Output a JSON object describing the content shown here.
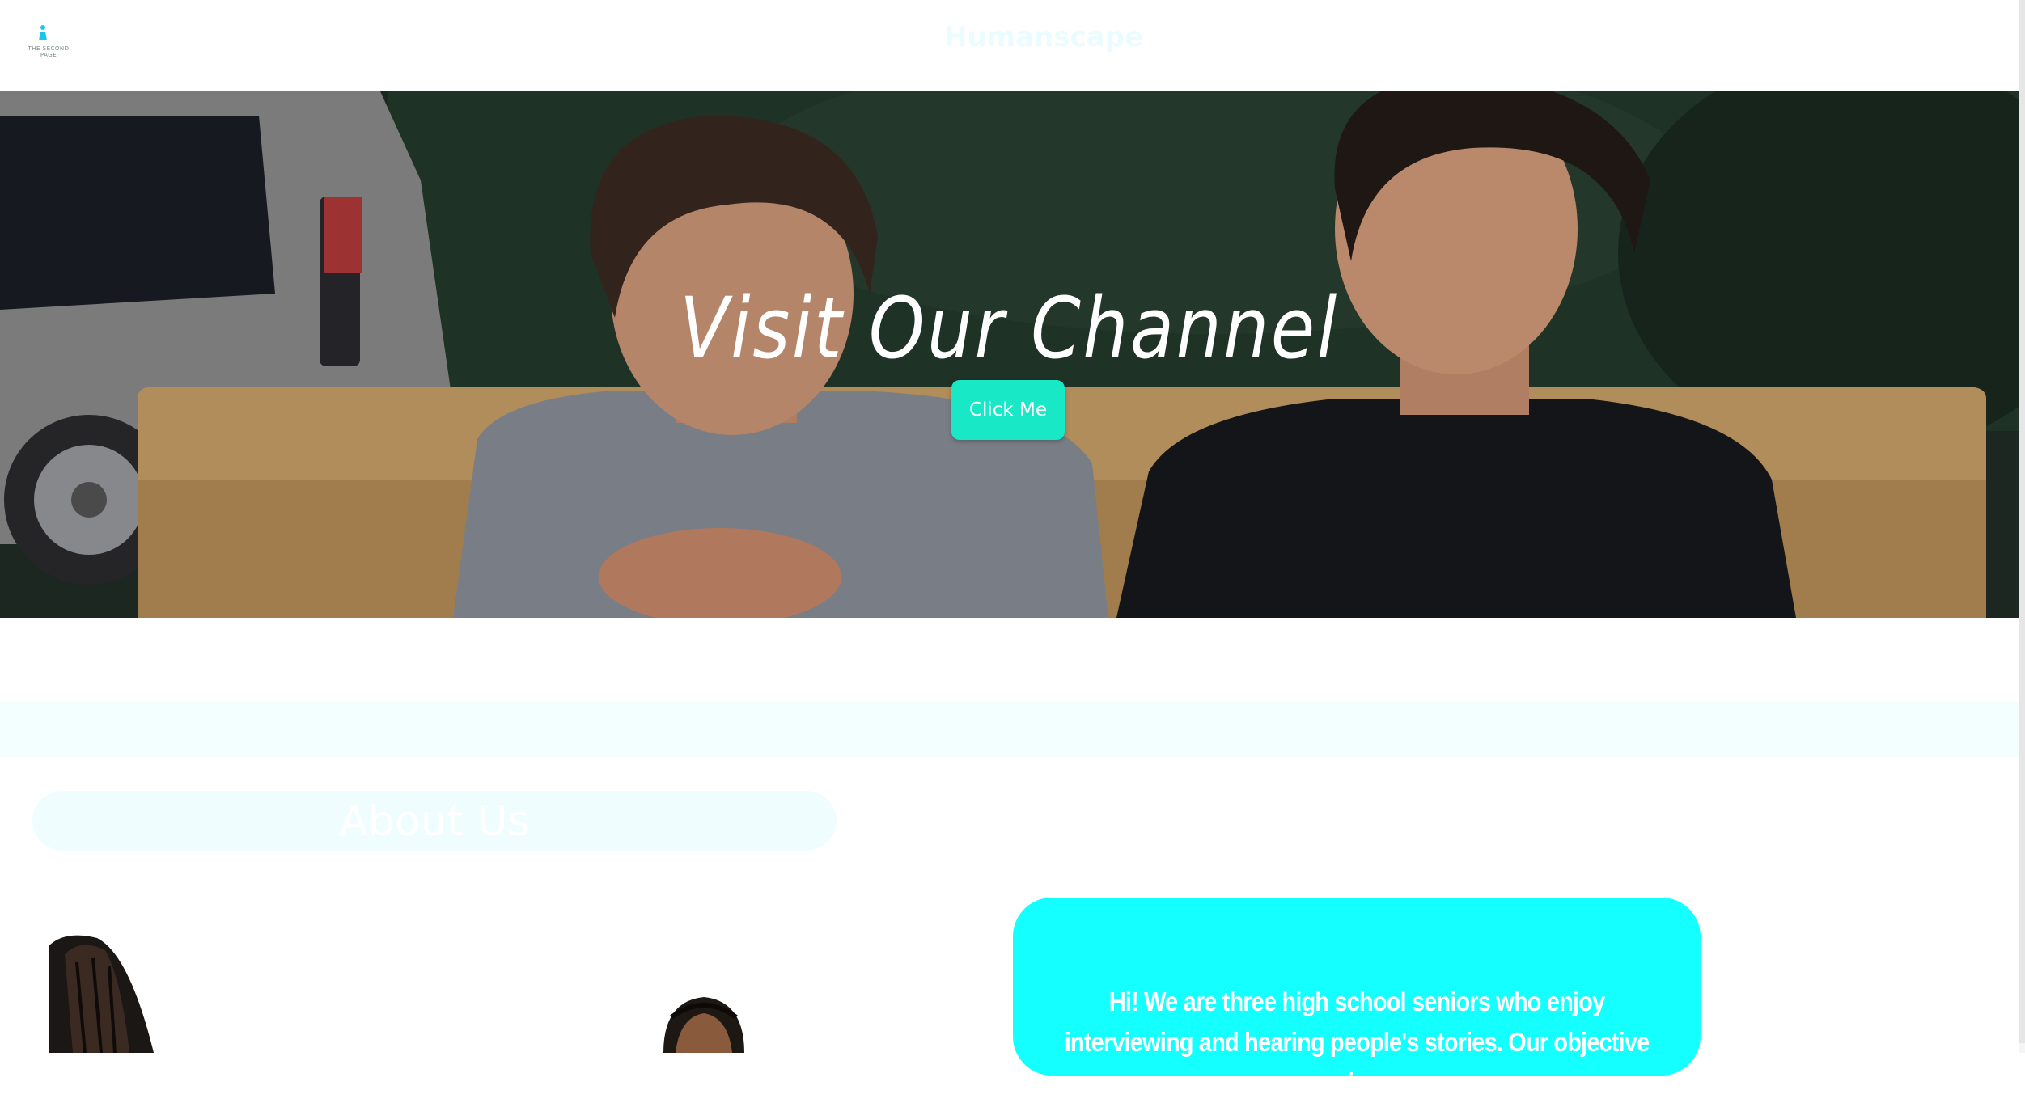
{
  "header": {
    "logo_text": "THE SECOND PAGE",
    "site_name": "Humanscape"
  },
  "hero": {
    "title": "Visit Our Channel",
    "button_label": "Click Me"
  },
  "about": {
    "title": "About Us",
    "intro": "Hi! We are three high school seniors who enjoy interviewing and hearing people's stories. Our objective is"
  },
  "colors": {
    "accent": "#19e8c6",
    "card": "#14ffff",
    "band": "#f3feff"
  }
}
